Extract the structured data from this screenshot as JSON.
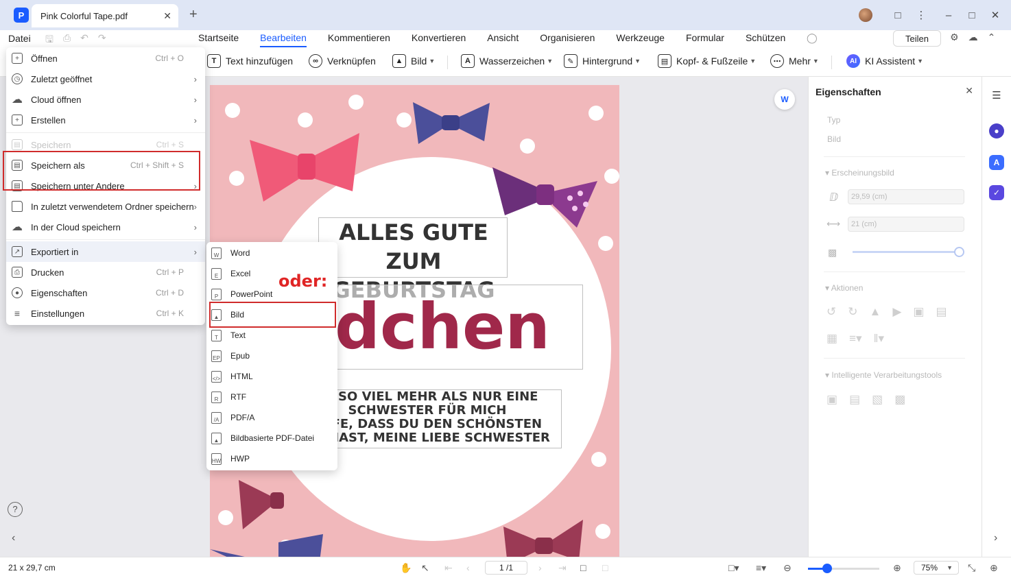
{
  "titlebar": {
    "app_logo": "P",
    "tab_title": "Pink Colorful Tape.pdf",
    "tab_close": "✕",
    "new_tab": "+",
    "icons": [
      "avatar",
      "feedback-icon",
      "more-vertical-icon",
      "minimize-icon",
      "maximize-icon",
      "close-icon"
    ]
  },
  "menubar": {
    "datei": "Datei",
    "items": [
      "Startseite",
      "Bearbeiten",
      "Kommentieren",
      "Konvertieren",
      "Ansicht",
      "Organisieren",
      "Werkzeuge",
      "Formular",
      "Schützen"
    ],
    "active": "Bearbeiten",
    "share": "Teilen"
  },
  "toolbar": {
    "add_text": "Text hinzufügen",
    "link": "Verknüpfen",
    "image": "Bild",
    "watermark": "Wasserzeichen",
    "background": "Hintergrund",
    "header_footer": "Kopf- & Fußzeile",
    "more": "Mehr",
    "ai_badge": "AI",
    "ai_assistant": "KI Assistent"
  },
  "datei_menu": {
    "items": [
      {
        "label": "Öffnen",
        "shortcut": "Ctrl + O",
        "icon": "plus-icon"
      },
      {
        "label": "Zuletzt geöffnet",
        "arrow": "›",
        "icon": "clock-icon"
      },
      {
        "label": "Cloud öffnen",
        "arrow": "›",
        "icon": "cloud-icon"
      },
      {
        "label": "Erstellen",
        "arrow": "›",
        "icon": "create-icon"
      },
      {
        "label": "Speichern",
        "shortcut": "Ctrl + S",
        "icon": "save-icon"
      },
      {
        "label": "Speichern als",
        "shortcut": "Ctrl + Shift + S",
        "icon": "save-as-icon"
      },
      {
        "label": "Speichern unter Andere",
        "arrow": "›",
        "icon": "save-other-icon"
      },
      {
        "label": "In zuletzt verwendetem Ordner speichern",
        "arrow": "›",
        "icon": "folder-icon"
      },
      {
        "label": "In der Cloud speichern",
        "arrow": "›",
        "icon": "cloud-upload-icon"
      },
      {
        "label": "Exportiert in",
        "arrow": "›",
        "icon": "export-icon"
      },
      {
        "label": "Drucken",
        "shortcut": "Ctrl + P",
        "icon": "print-icon"
      },
      {
        "label": "Eigenschaften",
        "shortcut": "Ctrl + D",
        "icon": "properties-icon"
      },
      {
        "label": "Einstellungen",
        "shortcut": "Ctrl + K",
        "icon": "settings-icon"
      }
    ]
  },
  "export_menu": {
    "items": [
      "Word",
      "Excel",
      "PowerPoint",
      "Bild",
      "Text",
      "Epub",
      "HTML",
      "RTF",
      "PDF/A",
      "Bildbasierte PDF-Datei",
      "HWP"
    ],
    "icon_marks": [
      "W",
      "E",
      "P",
      "",
      "T",
      "EP",
      "</>",
      "R",
      "/A",
      "",
      "HW"
    ]
  },
  "annotation": {
    "oder": "oder:"
  },
  "document": {
    "title": "ALLES GUTE ZUM GEBURTSTAG",
    "big": "ädchen",
    "sub_lines": [
      "ST SO VIEL MEHR ALS NUR EINE",
      "SCHWESTER FÜR MICH",
      "OFFE, DASS DU DEN SCHÖNSTEN",
      "AG HAST, MEINE LIEBE SCHWESTER"
    ]
  },
  "properties": {
    "title": "Eigenschaften",
    "type_label": "Typ",
    "type_value": "Bild",
    "appearance": "Erscheinungsbild",
    "height": "29,59 (cm)",
    "width": "21 (cm)",
    "opacity": 1.0,
    "actions": "Aktionen",
    "smart_tools": "Intelligente Verarbeitungstools"
  },
  "statusbar": {
    "size": "21 x 29,7 cm",
    "page": "1 /1",
    "zoom": "75%",
    "zoom_level": 0.27
  },
  "colors": {
    "accent": "#1a5cff",
    "annotation_red": "#d02b2b",
    "page_pink": "#f1b8bb",
    "headline_wine": "#a0284a"
  }
}
